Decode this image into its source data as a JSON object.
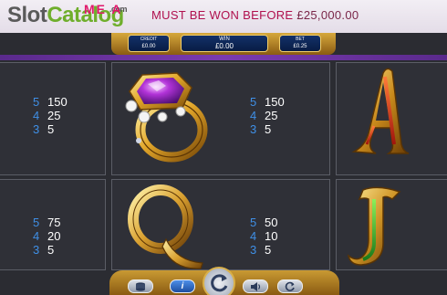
{
  "banner": {
    "logo_slot": "Slot",
    "logo_catalog": "Catalog",
    "logo_com": ".com",
    "mega": "ME    A",
    "promo_text": "MUST BE WON BEFORE",
    "promo_amount": "£25,000.00"
  },
  "meters": {
    "credit_label": "CREDIT",
    "credit_value": "£0.00",
    "win_label": "WIN",
    "win_value": "£0.00",
    "bet_label": "BET",
    "bet_value": "£0.25"
  },
  "paytable": {
    "ring": [
      {
        "count": "5",
        "amount": "150"
      },
      {
        "count": "4",
        "amount": "25"
      },
      {
        "count": "3",
        "amount": "5"
      }
    ],
    "letter_a": [
      {
        "count": "5",
        "amount": "150"
      },
      {
        "count": "4",
        "amount": "25"
      },
      {
        "count": "3",
        "amount": "5"
      }
    ],
    "letter_q": [
      {
        "count": "5",
        "amount": "75"
      },
      {
        "count": "4",
        "amount": "20"
      },
      {
        "count": "3",
        "amount": "5"
      }
    ],
    "letter_j": [
      {
        "count": "5",
        "amount": "50"
      },
      {
        "count": "4",
        "amount": "10"
      },
      {
        "count": "3",
        "amount": "5"
      }
    ]
  },
  "symbols": {
    "a": "A",
    "q": "Q",
    "j": "J"
  },
  "controls": {
    "menu_icon": "stack-icon",
    "info_icon": "info-icon",
    "spin_icon": "refresh-icon",
    "sound_icon": "speaker-icon",
    "autoplay_icon": "autoplay-icon",
    "info_glyph": "i"
  },
  "colors": {
    "pay_count": "#3f8fe6",
    "promo": "#b0104e",
    "gold": "#d9a53a",
    "purple": "#6a2fa0"
  }
}
